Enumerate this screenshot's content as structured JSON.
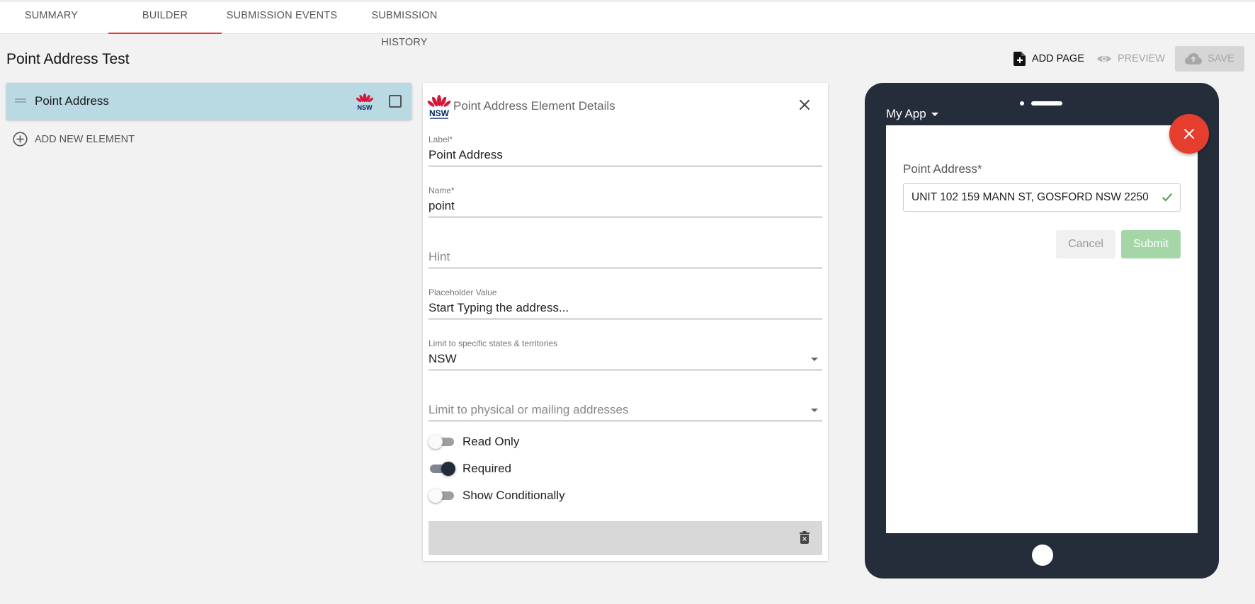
{
  "tabs": [
    {
      "label": "SUMMARY"
    },
    {
      "label": "BUILDER",
      "active": true
    },
    {
      "label": "SUBMISSION EVENTS"
    },
    {
      "label": "SUBMISSION HISTORY"
    }
  ],
  "page": {
    "title": "Point Address Test",
    "actions": {
      "add_page": "ADD PAGE",
      "preview": "PREVIEW",
      "save": "SAVE"
    }
  },
  "elements": {
    "items": [
      {
        "label": "Point Address",
        "icon": "nsw-logo-icon",
        "checked": false
      }
    ],
    "add_label": "ADD NEW ELEMENT"
  },
  "details": {
    "title": "Point Address Element Details",
    "fields": {
      "label": {
        "label": "Label*",
        "value": "Point Address"
      },
      "name": {
        "label": "Name*",
        "value": "point"
      },
      "hint": {
        "placeholder": "Hint"
      },
      "placeholder": {
        "label": "Placeholder Value",
        "value": "Start Typing the address..."
      },
      "states": {
        "label": "Limit to specific states & territories",
        "value": "NSW"
      },
      "address_type": {
        "placeholder": "Limit to physical or mailing addresses"
      }
    },
    "toggles": [
      {
        "label": "Read Only",
        "on": false
      },
      {
        "label": "Required",
        "on": true
      },
      {
        "label": "Show Conditionally",
        "on": false
      }
    ]
  },
  "preview": {
    "app_name": "My App",
    "field_label": "Point Address*",
    "field_value": "UNIT 102 159 MANN ST, GOSFORD NSW 2250",
    "cancel": "Cancel",
    "submit": "Submit"
  },
  "colors": {
    "accent": "#e53935",
    "selected_item": "#b9d9e3",
    "phone_frame": "#252d3b",
    "submit_disabled": "#a5d6a7",
    "fab": "#e53e2e"
  }
}
